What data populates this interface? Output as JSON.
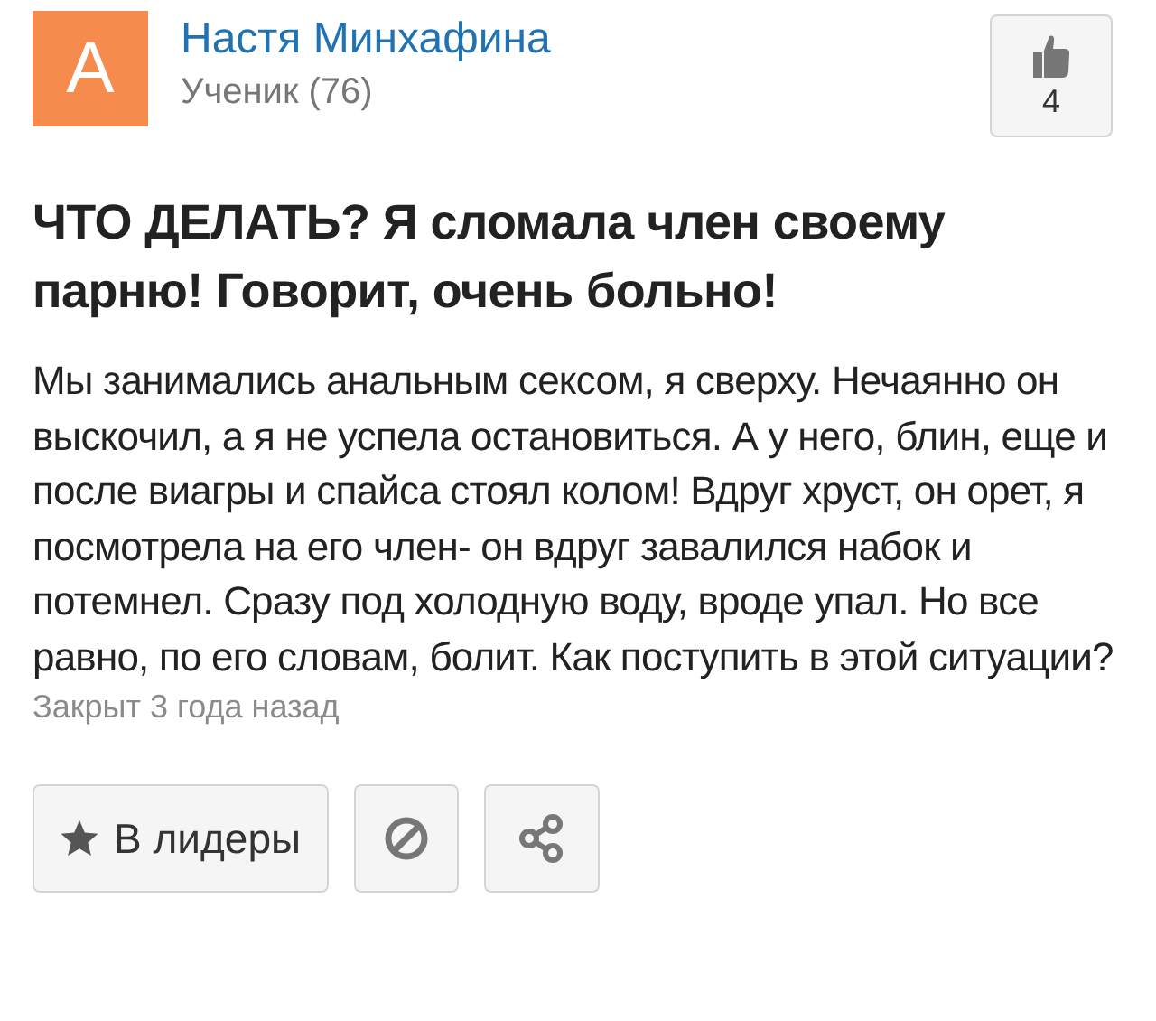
{
  "author": {
    "avatar_letter": "А",
    "name": "Настя Минхафина",
    "rank": "Ученик (76)"
  },
  "like_button": {
    "count": "4"
  },
  "question": {
    "title": "ЧТО ДЕЛАТЬ? Я сломала член своему парню! Говорит, очень больно!",
    "body": "Мы занимались анальным сексом, я сверху. Нечаянно он выскочил, а я не успела остановиться. А у него, блин, еще и после виагры и спайса стоял колом! Вдруг хруст, он орет, я посмотрела на его член- он вдруг завалился набок и потемнел. Сразу под холодную воду, вроде упал. Но все равно, по его словам, болит. Как поступить в этой ситуации?",
    "status": "Закрыт 3 года назад"
  },
  "actions": [
    {
      "kind": "leaders",
      "label": "В лидеры"
    },
    {
      "kind": "block"
    },
    {
      "kind": "share"
    }
  ]
}
